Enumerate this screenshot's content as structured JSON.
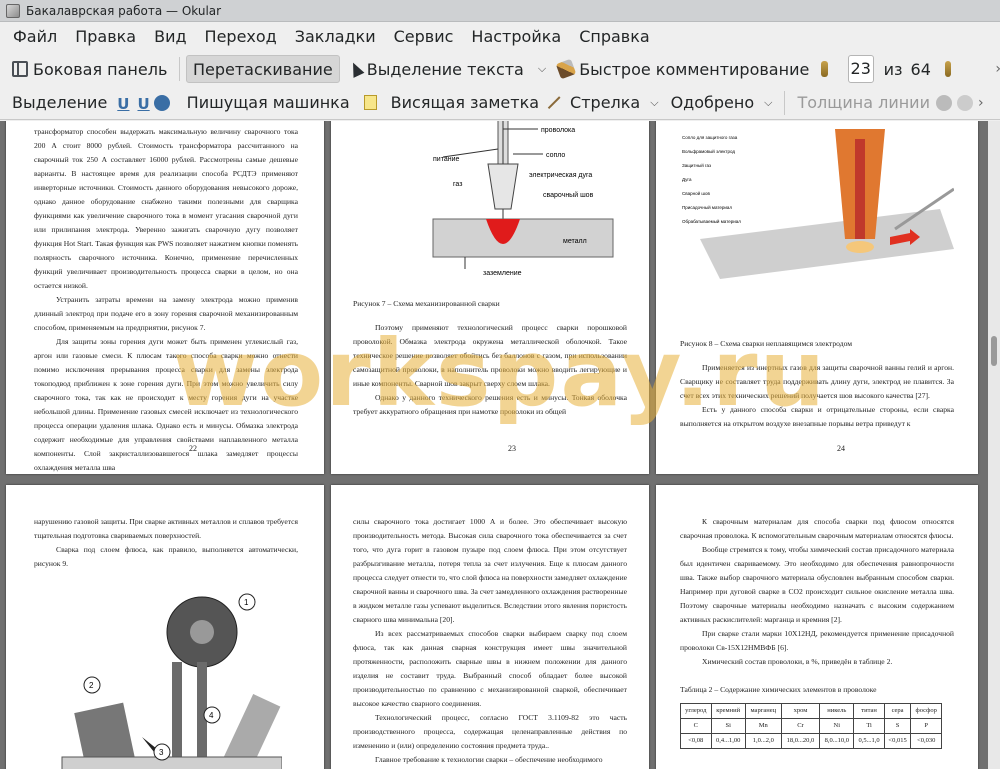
{
  "window": {
    "title": "Бакалаврская работа  — Okular"
  },
  "menu": [
    "Файл",
    "Правка",
    "Вид",
    "Переход",
    "Закладки",
    "Сервис",
    "Настройка",
    "Справка"
  ],
  "toolbar1": {
    "sidebar": "Боковая панель",
    "drag": "Перетаскивание",
    "text_select": "Выделение текста",
    "quick_annot": "Быстрое комментирование",
    "page_current": "23",
    "of_label": "из",
    "page_total": "64"
  },
  "toolbar2": {
    "selection": "Выделение",
    "typewriter": "Пишущая машинка",
    "inline_note": "Висящая заметка",
    "arrow": "Стрелка",
    "stamp": "Одобрено",
    "line_width": "Толщина линии"
  },
  "watermark": "workspay.ru",
  "pages": {
    "p22": {
      "paras": [
        "трансформатор способен выдержать максимальную величину сварочного тока 200 А стоит 8000 рублей. Стоимость трансформатора рассчитанного на сварочный ток 250 А составляет 16000 рублей. Рассмотрены самые дешевые варианты. В настоящее время для реализации способа РСДТЭ применяют инверторные источники. Стоимость данного оборудования невысокого дороже, однако данное оборудование снабжено такими полезными для сварщика функциями как увеличение сварочного тока в момент угасания сварочной дуги или прилипания электрода. Уверенно зажигать сварочную дугу позволяет функция Hot Start. Такая функция как PWS позволяет нажатием кнопки поменять полярность сварочного источника. Конечно, применение перечисленных функций увеличивает производительность процесса сварки в целом, но она остается низкой.",
        "Устранить затраты времени на замену электрода можно применив длинный электрод при подаче его в зону горения сварочной механизированным способом, применяемым на предприятии, рисунок 7.",
        "Для защиты зоны горения дуги может быть применен углекислый газ, аргон или газовые смеси. К плюсам такого способа сварки можно отнести помимо исключения прерывания процесса сварки для замены электрода токоподвод приближен к зоне горения дуги. При этом можно увеличить силу сварочного тока, так как не происходит к месту горения дуги на участке небольшой длины. Применение газовых смесей исключает из технологического процесса операции удаления шлака. Однако есть и минусы. Обмазка электрода содержит необходимые для управления свойствами наплавленного металла компоненты. Слой закристаллизовавшегося шлака замедляет процессы охлаждения металла шва"
      ],
      "number": "22"
    },
    "p23": {
      "labels": [
        "проволока",
        "питание",
        "сопло",
        "газ",
        "электрическая дуга",
        "сварочный шов",
        "металл",
        "заземление"
      ],
      "caption": "Рисунок 7 – Схема механизированной сварки",
      "paras": [
        "Поэтому применяют технологический процесс сварки порошковой проволокой. Обмазка электрода окружена металлической оболочкой. Такое техническое решение позволяет обойтись без баллонов с газом, при использовании самозащитной проволоки, в наполнитель проволоки можно вводить легирующие и иные компоненты. Сварной шов закрыт сверху слоем шлака.",
        "Однако у данного технического решения есть и минусы. Тонкая оболочка требует аккуратного обращения при намотке проволоки из общей"
      ],
      "number": "23"
    },
    "p24": {
      "labels": [
        "Сопло для защитного газа",
        "Вольфрамовый электрод",
        "Защитный газ",
        "Дуга",
        "Сварной шов",
        "Присадочный материал",
        "Обрабатываемый материал"
      ],
      "caption": "Рисунок 8 – Схема сварки неплавящимся электродом",
      "paras": [
        "Применяется из инертных газов для защиты сварочной ванны гелий и аргон. Сварщику не составляет труда поддерживать длину дуги, электрод не плавится. За счет всех этих технических решений получается шов высокого качества [27].",
        "Есть у данного способа сварки и отрицательные стороны, если сварка выполняется на открытом воздухе внезапные порывы ветра приведут к"
      ],
      "number": "24"
    },
    "p25": {
      "paras": [
        "нарушению газовой защиты. При сварке активных металлов и сплавов требуется тщательная подготовка свариваемых поверхностей.",
        "Сварка под слоем флюса, как правило, выполняется автоматически, рисунок 9."
      ],
      "callouts": [
        "1",
        "2",
        "3",
        "4"
      ]
    },
    "p26": {
      "paras": [
        "силы сварочного тока достигает 1000 А и более. Это обеспечивает высокую производительность метода. Высокая сила сварочного тока обеспечивается за счет того, что дуга горит в газовом пузыре под слоем флюса. При этом отсутствует разбрызгивание металла, потеря тепла за счет излучения. Еще к плюсам данного процесса следует отнести то, что слой флюса на поверхности замедляет охлаждение сварочной ванны и сварочного шва. За счет замедленного охлаждения растворенные в жидком металле газы успевают выделиться. Вследствии этого явления пористость сварного шва минимальна [20].",
        "Из всех рассматриваемых способов сварки выбираем сварку под слоем флюса, так как данная сварная конструкция имеет швы значительной протяженности, расположить сварные швы в нижнем положении для данного изделия не составит труда. Выбранный способ обладает более высокой производительностью по сравнению с механизированной сваркой, обеспечивает высокое качество сварного соединения.",
        "Технологический процесс, согласно ГОСТ 3.1109-82 это часть производственного процесса, содержащая целенаправленные действия по изменению и (или) определению состояния предмета труда..",
        "Главное требование к технологии сварки – обеспечение необходимого"
      ]
    },
    "p27": {
      "paras": [
        "К сварочным материалам для способа сварки под флюсом относятся сварочная проволока. К вспомогательным сварочным материалам относятся флюсы.",
        "Вообще стремятся к тому, чтобы химический состав присадочного материала был идентичен свариваемому. Это необходимо для обеспечения равнопрочности шва. Также выбор сварочного материала обусловлен выбранным способом сварки. Например при дуговой сварке в CO2 происходит сильное окисление металла шва. Поэтому сварочные материалы необходимо назначать с высоким содержанием активных раскислителей: марганца и кремния [2].",
        "При сварке стали марки 10Х12НД, рекомендуется применение присадочной проволоки Св-15Х12НМВФБ [6].",
        "Химический состав проволоки, в %, приведён в таблице 2."
      ],
      "table_title": "Таблица 2 – Содержание химических элементов в проволоке",
      "table_head": [
        "углерод",
        "кремний",
        "марганец",
        "хром",
        "никель",
        "титан",
        "сера",
        "фосфор"
      ],
      "table_sym": [
        "C",
        "Si",
        "Mn",
        "Cr",
        "Ni",
        "Ti",
        "S",
        "P"
      ],
      "table_row": [
        "<0,08",
        "0,4...1,00",
        "1,0...2,0",
        "18,0...20,0",
        "8,0...10,0",
        "0,5...1,0",
        "<0,015",
        "<0,030"
      ]
    }
  }
}
